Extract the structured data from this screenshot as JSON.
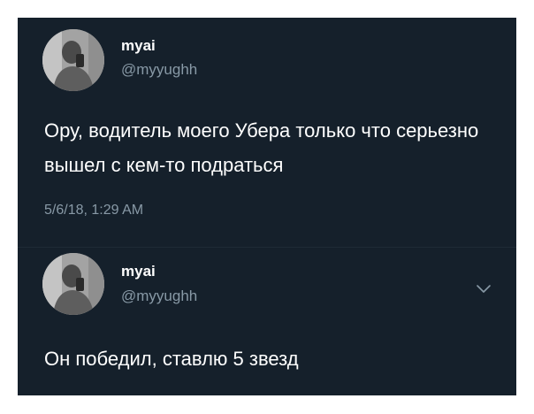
{
  "colors": {
    "panel_background": "#15202b",
    "text_primary": "#ffffff",
    "text_secondary": "#8899a6"
  },
  "tweets": [
    {
      "display_name": "myai",
      "handle": "@myyughh",
      "text": "Ору, водитель моего Убера только что серьезно вышел с кем-то подраться",
      "timestamp": "5/6/18, 1:29 AM",
      "avatar_icon": "user-avatar"
    },
    {
      "display_name": "myai",
      "handle": "@myyughh",
      "text": "Он победил, ставлю 5 звезд",
      "avatar_icon": "user-avatar",
      "menu_icon": "chevron-down-icon"
    }
  ]
}
